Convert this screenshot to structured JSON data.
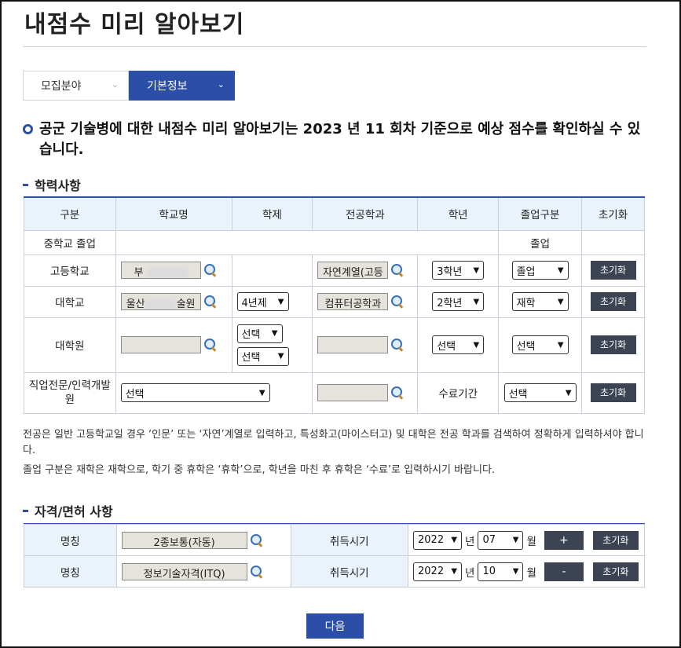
{
  "page_title": "내점수 미리 알아보기",
  "tabs": [
    {
      "label": "모집분야"
    },
    {
      "label": "기본정보"
    }
  ],
  "notice": "공군 기술병에 대한 내점수 미리 알아보기는 2023 년 11 회차 기준으로 예상 점수를 확인하실 수 있습니다.",
  "education": {
    "section_title": "학력사항",
    "headers": [
      "구분",
      "학교명",
      "학제",
      "전공학과",
      "학년",
      "졸업구분",
      "초기화"
    ],
    "middle_school": {
      "label": "중학교 졸업",
      "graduation": "졸업"
    },
    "high_school": {
      "label": "고등학교",
      "school": "부",
      "major": "자연계열(고등",
      "grade": "3학년",
      "graduation": "졸업",
      "reset": "초기화"
    },
    "university": {
      "label": "대학교",
      "school_prefix": "울산",
      "school_suffix": "술원",
      "system": "4년제",
      "major": "컴퓨터공학과",
      "grade": "2학년",
      "graduation": "재학",
      "reset": "초기화"
    },
    "graduate": {
      "label": "대학원",
      "system_1": "선택",
      "system_2": "선택",
      "grade": "선택",
      "graduation": "선택",
      "reset": "초기화"
    },
    "vocational": {
      "label": "직업전문/인력개발원",
      "school_select": "선택",
      "period_label": "수료기간",
      "period_select": "선택",
      "reset": "초기화"
    }
  },
  "notes": [
    "전공은 일반 고등학교일 경우 ‘인문’ 또는 ‘자연’계열로 입력하고, 특성화고(마이스터고) 및 대학은 전공 학과를 검색하여 정확하게 입력하셔야 합니다.",
    "졸업 구분은 재학은 재학으로, 학기 중 휴학은 ‘휴학’으로, 학년을 마친 후 휴학은 ‘수료’로 입력하시기 바랍니다."
  ],
  "license": {
    "section_title": "자격/면허 사항",
    "rows": [
      {
        "name_label": "명칭",
        "name_value": "2종보통(자동)",
        "date_label": "취득시기",
        "year": "2022",
        "year_unit": "년",
        "month": "07",
        "month_unit": "월",
        "pm": "+",
        "reset": "초기화"
      },
      {
        "name_label": "명칭",
        "name_value": "정보기술자격(ITQ)",
        "date_label": "취득시기",
        "year": "2022",
        "year_unit": "년",
        "month": "10",
        "month_unit": "월",
        "pm": "-",
        "reset": "초기화"
      }
    ]
  },
  "next_button": "다음"
}
